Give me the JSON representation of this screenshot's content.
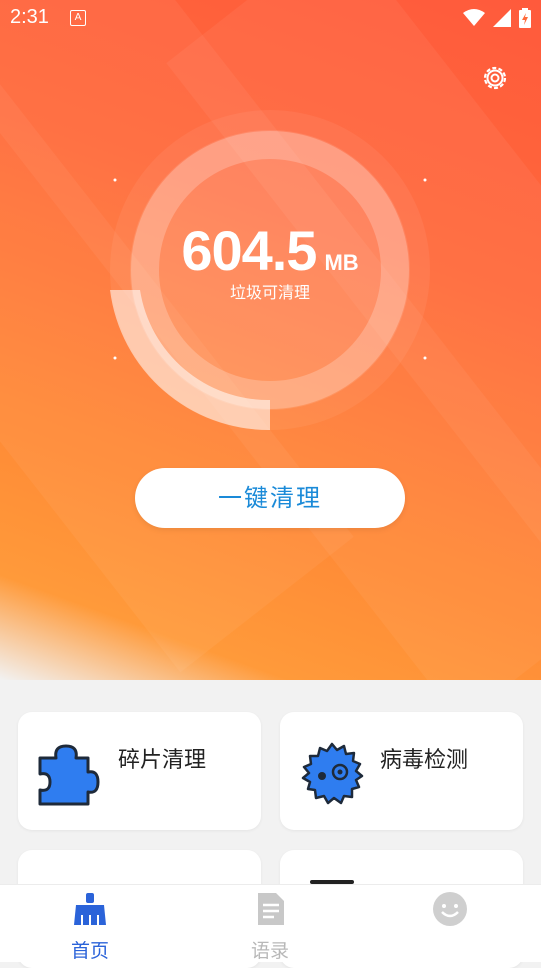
{
  "status_bar": {
    "time": "2:31",
    "app_badge": "A"
  },
  "hero": {
    "size_value": "604.5",
    "size_unit": "MB",
    "subtitle": "垃圾可清理",
    "clean_button": "一键清理",
    "accent": "#ff6a3a",
    "button_text_color": "#1a8ad8"
  },
  "cards": [
    {
      "label": "碎片清理",
      "icon": "puzzle-icon"
    },
    {
      "label": "病毒检测",
      "icon": "virus-icon"
    }
  ],
  "tabs": [
    {
      "label": "首页",
      "icon": "home-broom-icon",
      "active": true
    },
    {
      "label": "语录",
      "icon": "document-icon",
      "active": false
    },
    {
      "label": "",
      "icon": "smiley-icon",
      "active": false
    }
  ],
  "colors": {
    "tab_active": "#2b63d9",
    "tab_inactive": "#b8b8b8"
  }
}
